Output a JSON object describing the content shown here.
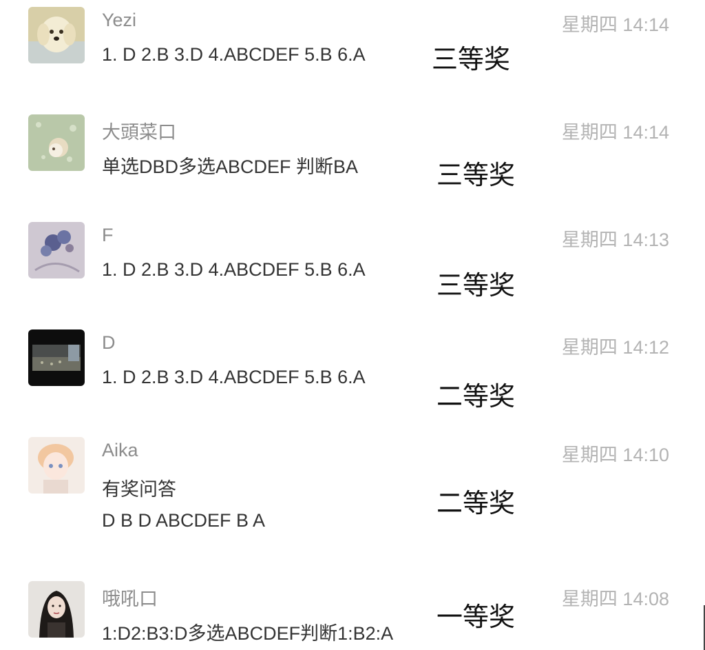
{
  "comments": [
    {
      "name": "Yezi",
      "time": "星期四 14:14",
      "lines": [
        "1. D 2.B 3.D 4.ABCDEF 5.B 6.A"
      ],
      "prize": "三等奖"
    },
    {
      "name": "大頭菜口",
      "time": "星期四 14:14",
      "lines": [
        "单选DBD多选ABCDEF 判断BA"
      ],
      "prize": "三等奖"
    },
    {
      "name": "F",
      "time": "星期四 14:13",
      "lines": [
        "1. D 2.B 3.D 4.ABCDEF 5.B 6.A"
      ],
      "prize": "三等奖"
    },
    {
      "name": "D",
      "time": "星期四 14:12",
      "lines": [
        "1. D 2.B 3.D 4.ABCDEF 5.B 6.A"
      ],
      "prize": "二等奖"
    },
    {
      "name": "Aika",
      "time": "星期四 14:10",
      "lines": [
        "有奖问答",
        "D B D ABCDEF B A"
      ],
      "prize": "二等奖"
    },
    {
      "name": "哦吼口",
      "time": "星期四 14:08",
      "lines": [
        "1:D2:B3:D多选ABCDEF判断1:B2:A"
      ],
      "prize": "一等奖"
    }
  ]
}
